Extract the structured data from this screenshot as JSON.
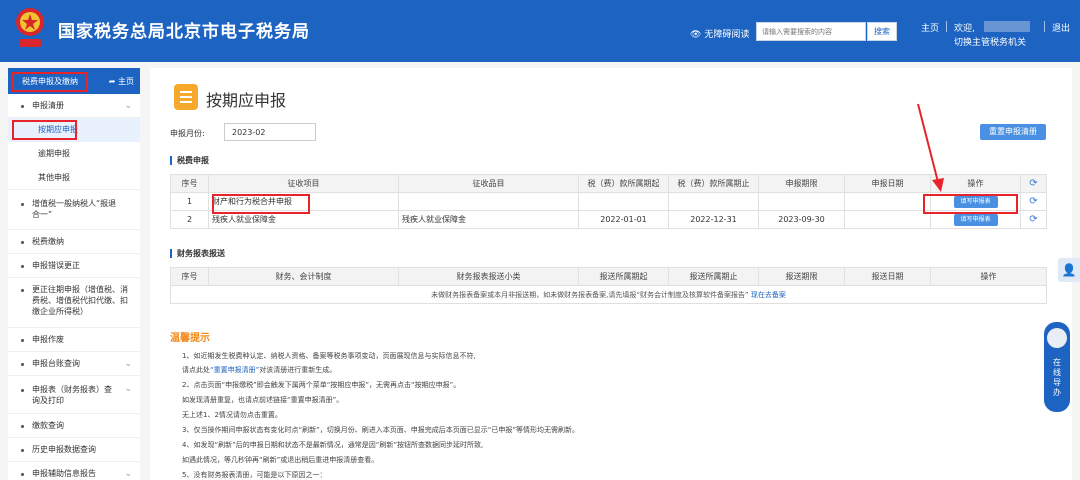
{
  "header": {
    "title": "国家税务总局北京市电子税务局",
    "accessibility": "无障碍阅读",
    "search_placeholder": "请输入需要搜索的内容",
    "search_button": "搜索",
    "home": "主页",
    "welcome": "欢迎,",
    "switch_authority": "切换主管税务机关",
    "logout": "退出",
    "colors": {
      "brand": "#1d63c2",
      "highlight": "#e8232a"
    }
  },
  "sidebar": {
    "header_label": "税费申报及缴纳",
    "home_label": "主页",
    "items": [
      {
        "label": "申报清册",
        "expandable": true,
        "children": [
          {
            "label": "按期应申报",
            "active": true
          },
          {
            "label": "逾期申报"
          },
          {
            "label": "其他申报"
          }
        ]
      },
      {
        "label": "增值税一般纳税人“报退合一”"
      },
      {
        "label": "税费缴纳"
      },
      {
        "label": "申报错误更正"
      },
      {
        "label": "更正往期申报（增值税、消费税、增值税代扣代缴、扣缴企业所得税）"
      },
      {
        "label": "申报作废"
      },
      {
        "label": "申报台账查询",
        "expandable": true
      },
      {
        "label": "申报表（财务报表）查询及打印",
        "expandable": true
      },
      {
        "label": "缴款查询"
      },
      {
        "label": "历史申报数据查询"
      },
      {
        "label": "申报辅助信息报告",
        "expandable": true
      }
    ]
  },
  "main": {
    "page_title": "按期应申报",
    "month_label": "申报月份:",
    "month_value": "2023-02",
    "reset_button": "重置申报清册",
    "tax_section": {
      "title": "税费申报",
      "columns": [
        "序号",
        "征收项目",
        "征收品目",
        "税（费）款所属期起",
        "税（费）款所属期止",
        "申报期限",
        "申报日期",
        "操作"
      ],
      "rows": [
        {
          "no": "1",
          "item": "财产和行为税合并申报",
          "subitem": "",
          "start": "",
          "end": "",
          "deadline": "",
          "date": "",
          "action": "填写申报表"
        },
        {
          "no": "2",
          "item": "残疾人就业保障金",
          "subitem": "残疾人就业保障金",
          "start": "2022-01-01",
          "end": "2022-12-31",
          "deadline": "2023-09-30",
          "date": "",
          "action": "填写申报表"
        }
      ]
    },
    "finance_section": {
      "title": "财务报表报送",
      "columns": [
        "序号",
        "财务、会计制度",
        "财务报表报送小类",
        "报送所属期起",
        "报送所属期止",
        "报送期限",
        "报送日期",
        "操作"
      ],
      "note": "未做财务报表备案或本月非报送期，如未做财务报表备案,请先填报“财务会计制度及核算软件备案报告”",
      "note_link": "现在去备案"
    },
    "tips": {
      "title": "温馨提示",
      "lines": [
        {
          "text": "1、如近期发生税费种认定、纳税人资格、备案等税务事项变动，页面展现信息与实际信息不符,",
          "link": ""
        },
        {
          "text": "请点此处",
          "link": "“重置申报清册”",
          "after": "对该清册进行重新生成。"
        },
        {
          "text": "2、点击页面“申报缴税”即会触发下属两个菜单“按期应申报”，无需再点击“按期应申报”。",
          "link": ""
        },
        {
          "text": "如发现清册重复，也请点前述链接“重置申报清册”。",
          "link": ""
        },
        {
          "text": "无上述1、2情况请勿点击重置。",
          "link": ""
        },
        {
          "text": "3、仅当操作期间申报状态有变化时点“刷新”，切换月份、刷进入本页面、申报完成后本页面已显示“已申报”等情形均无需刷新。",
          "link": ""
        },
        {
          "text": "4、如发现“刷新”后的申报日期和状态不是最新情况，通常是因“刷新”按钮所查数据同步延时所致,",
          "link": ""
        },
        {
          "text": "如遇此情况，等几秒钟再“刷新”或退出稍后重进申报清册查看。",
          "link": ""
        },
        {
          "text": "5、没有财务报表清册，可能是以下原因之一：",
          "link": ""
        }
      ]
    }
  },
  "float": {
    "online_service": "在线导办"
  }
}
